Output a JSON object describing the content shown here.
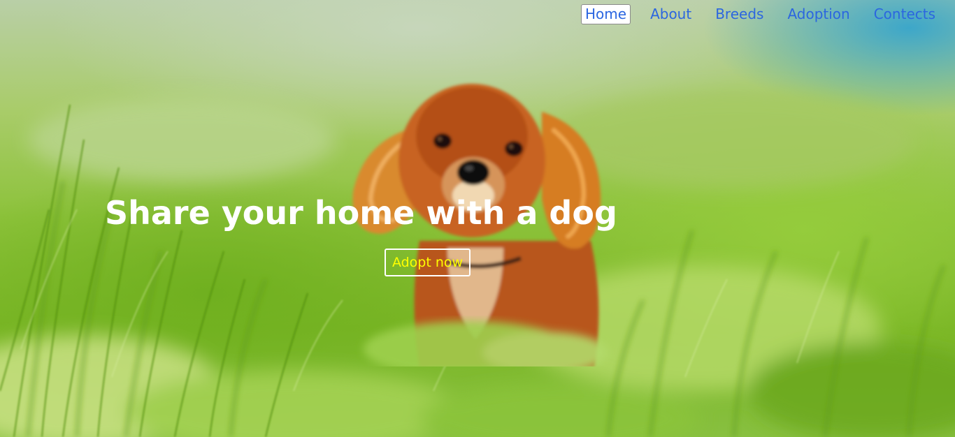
{
  "nav": {
    "items": [
      {
        "label": "Home",
        "active": true
      },
      {
        "label": "About",
        "active": false
      },
      {
        "label": "Breeds",
        "active": false
      },
      {
        "label": "Adoption",
        "active": false
      },
      {
        "label": "Contects",
        "active": false
      }
    ]
  },
  "hero": {
    "headline": "Share your home with a dog",
    "cta_label": "Adopt now",
    "background_icon": "dog-in-grass-photo"
  },
  "colors": {
    "nav_link": "#2b66e0",
    "headline": "#ffffff",
    "cta_text": "#ffff00",
    "cta_border": "#ffffff",
    "grass_green": "#8cc23a",
    "sky_blue": "#28a0d2",
    "dog_fur": "#c8621a"
  }
}
